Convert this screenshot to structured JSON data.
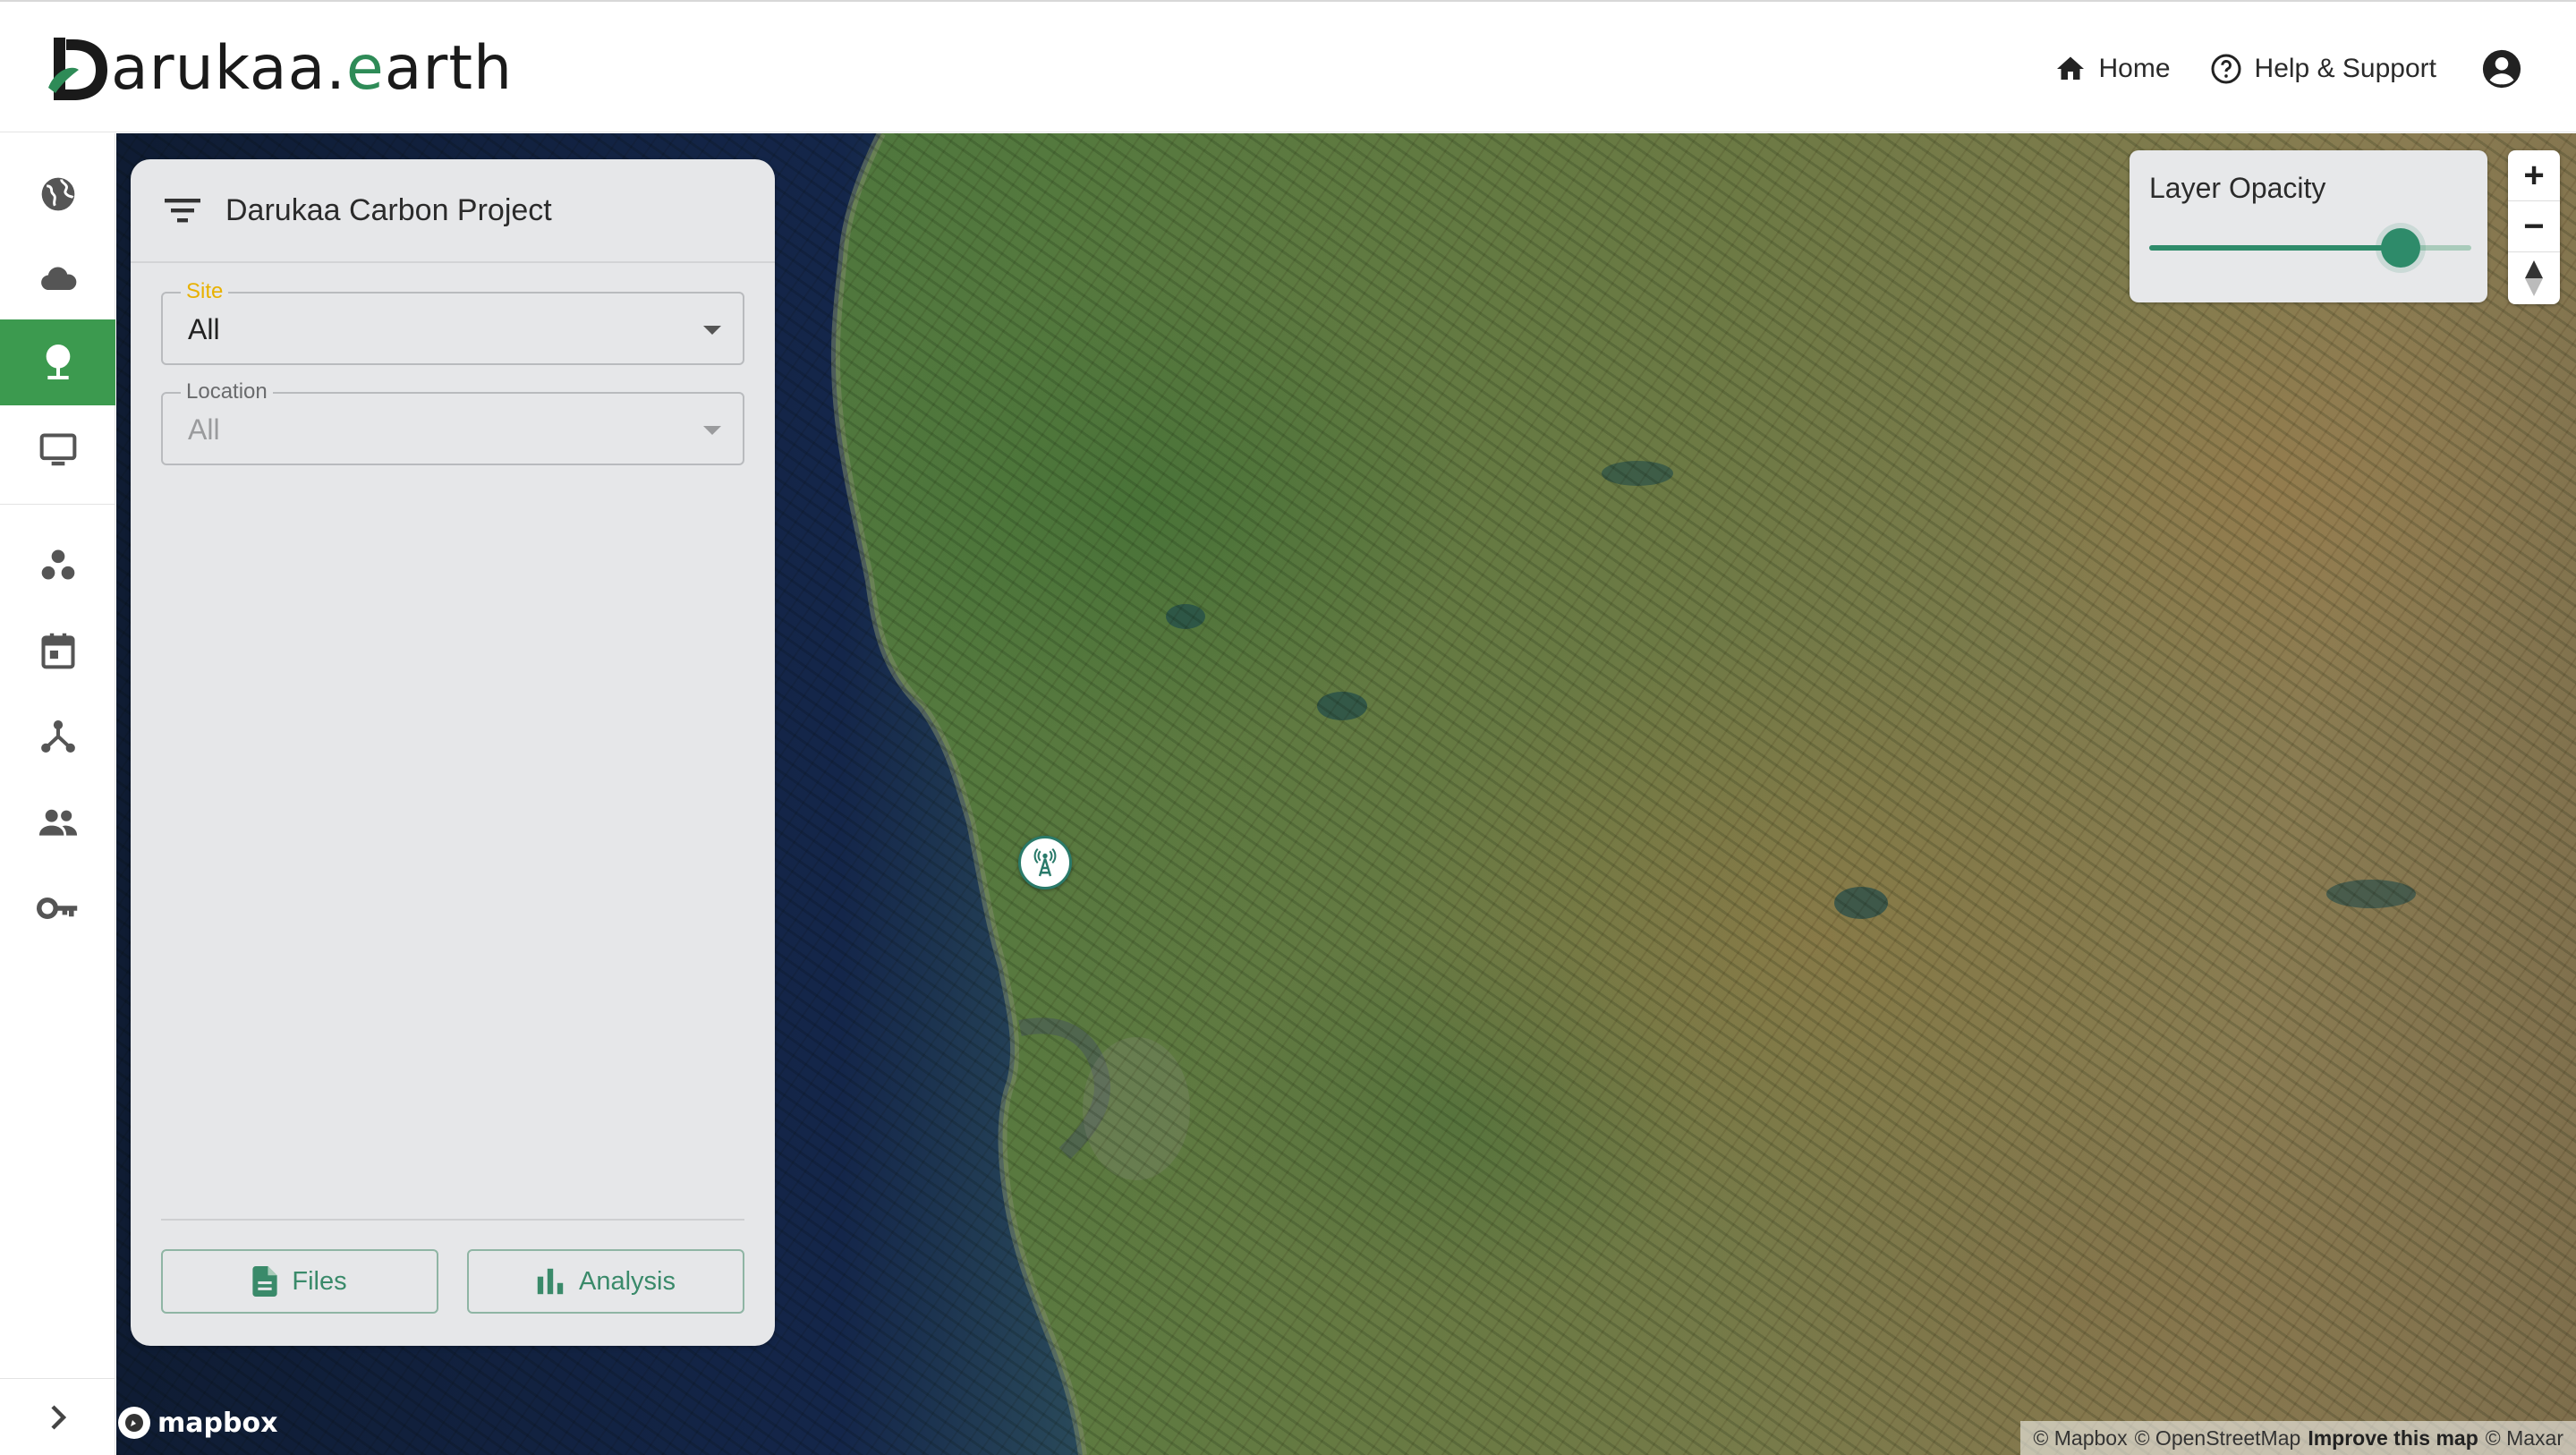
{
  "header": {
    "logo": {
      "letter": "D",
      "text_main": "arukaa",
      "text_dot": ".",
      "text_accent": "e",
      "text_end": "arth"
    },
    "nav": [
      {
        "label": "Home",
        "icon": "home-icon"
      },
      {
        "label": "Help & Support",
        "icon": "help-circle-icon"
      }
    ],
    "account_icon": "account-circle-icon"
  },
  "sidebar": {
    "items": [
      {
        "icon": "globe-icon",
        "active": false
      },
      {
        "icon": "cloud-icon",
        "active": false
      },
      {
        "icon": "tree-icon",
        "active": true
      },
      {
        "icon": "monitor-icon",
        "active": false
      },
      {
        "icon": "bubbles-icon",
        "active": false
      },
      {
        "icon": "calendar-icon",
        "active": false
      },
      {
        "icon": "network-icon",
        "active": false
      },
      {
        "icon": "people-icon",
        "active": false
      },
      {
        "icon": "key-icon",
        "active": false
      }
    ],
    "collapse_icon": "chevron-right-icon"
  },
  "panel": {
    "title": "Darukaa Carbon Project",
    "site_field": {
      "label": "Site",
      "value": "All"
    },
    "location_field": {
      "label": "Location",
      "value": "All",
      "disabled": true
    },
    "files_button": "Files",
    "analysis_button": "Analysis"
  },
  "opacity": {
    "title": "Layer Opacity",
    "value": 0.78
  },
  "zoom": {
    "in": "+",
    "out": "−"
  },
  "map": {
    "logo": "mapbox",
    "attribution": [
      "© Mapbox",
      "© OpenStreetMap",
      "Improve this map",
      "© Maxar"
    ],
    "marker_icon": "radio-tower-icon"
  },
  "colors": {
    "accent": "#3c9a4f",
    "teal": "#2e8b6a",
    "site_label": "#e8b100"
  }
}
